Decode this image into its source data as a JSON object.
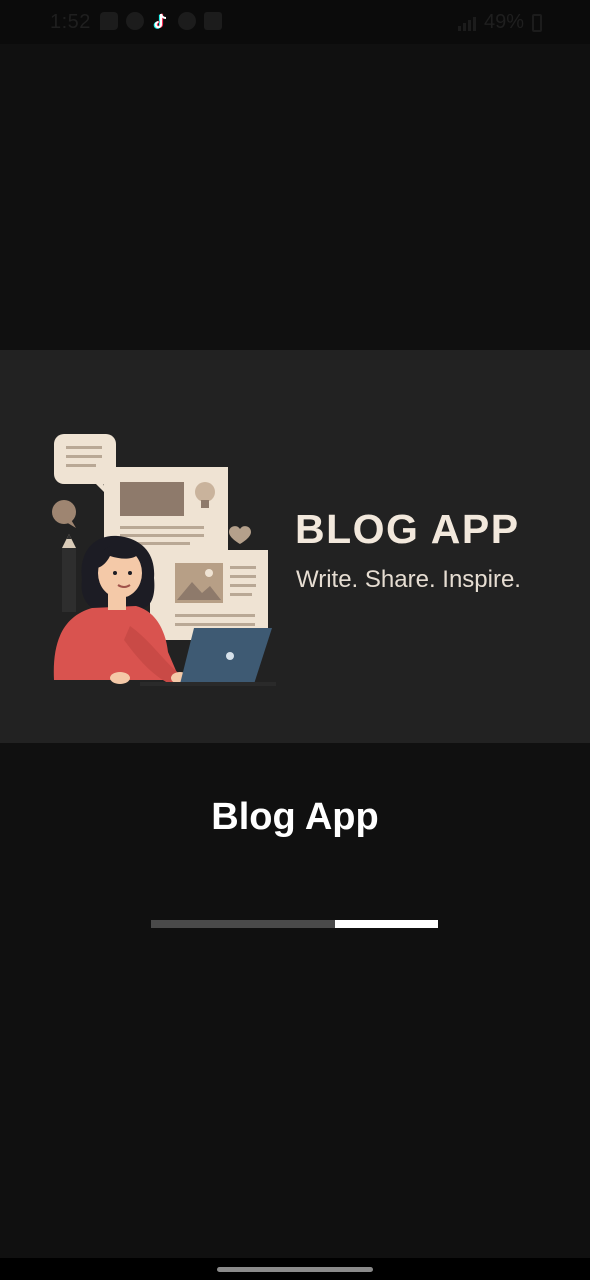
{
  "status_bar": {
    "time": "1:52",
    "battery": "49%",
    "icons": [
      "message-icon",
      "whatsapp-icon",
      "tiktok-icon",
      "info-icon",
      "mail-icon",
      "signal-icon",
      "battery-icon"
    ]
  },
  "banner": {
    "title": "BLOG APP",
    "tagline": "Write. Share. Inspire."
  },
  "app": {
    "name": "Blog App"
  },
  "loader": {
    "progress_start": 0.64,
    "progress_end": 1.0
  },
  "colors": {
    "background": "#101010",
    "banner_bg": "#222222",
    "title_color": "#f2e8dc",
    "accent_red": "#d9534f",
    "laptop_blue": "#3e5a73"
  }
}
